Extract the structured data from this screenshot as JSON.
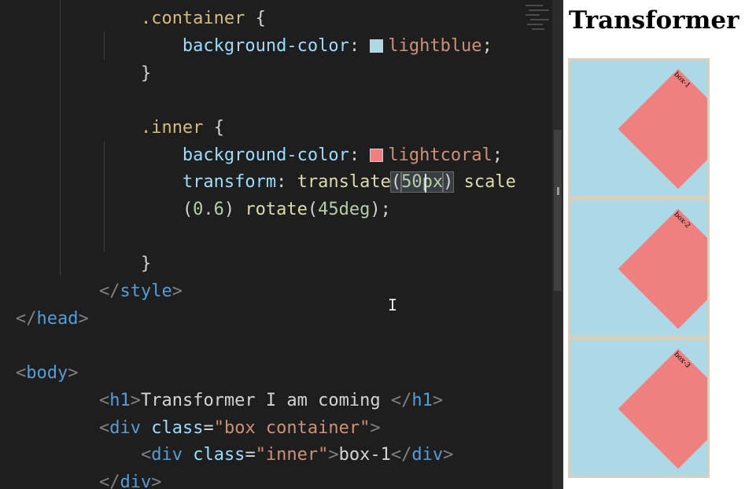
{
  "colors": {
    "lightblue": "#add8e6",
    "lightcoral": "#f08080"
  },
  "code": {
    "container_selector": ".container",
    "open_brace": "{",
    "close_brace": "}",
    "bg_prop": "background-color",
    "colon": ":",
    "semicolon": ";",
    "lightblue": "lightblue",
    "inner_selector": ".inner",
    "lightcoral": "lightcoral",
    "transform_prop": "transform",
    "translate_fn": "translate",
    "paren_open": "(",
    "paren_close": ")",
    "translate_val": "50px",
    "scale_fn": "scale",
    "scale_val": "0.6",
    "rotate_fn": "rotate",
    "rotate_val": "45deg",
    "style_close": "style",
    "head_close": "head",
    "body_open": "body",
    "h1_tag": "h1",
    "h1_text": "Transformer I am coming ",
    "div_tag": "div",
    "class_attr": "class",
    "equals": "=",
    "box_container_val": "\"box container\"",
    "inner_val": "\"inner\"",
    "box1_text": "box-1",
    "lt": "<",
    "lt_slash": "</",
    "gt": ">"
  },
  "preview": {
    "title": "Transformer I",
    "boxes": [
      "box-1",
      "box-2",
      "box-3"
    ]
  }
}
